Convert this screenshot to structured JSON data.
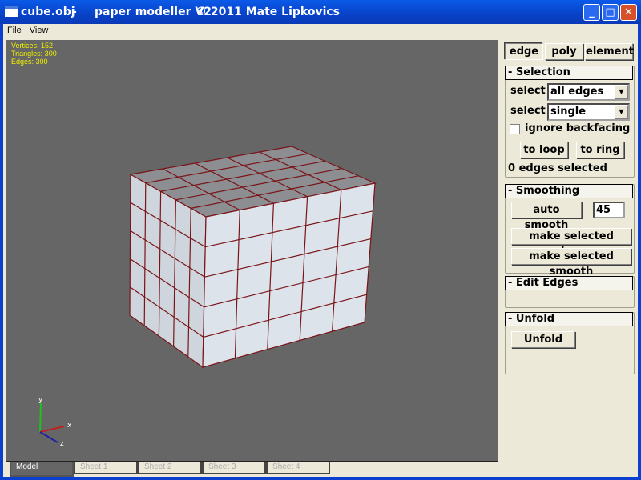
{
  "window": {
    "file": "cube.obj",
    "sep": "-",
    "app": "paper modeller V2",
    "copyright": "© 2011 Mate Lipkovics",
    "minimize": "_",
    "maximize": "□",
    "close": "✕"
  },
  "menu": [
    "File",
    "View"
  ],
  "stats": {
    "vertices": "Vertices: 152",
    "triangles": "Triangles: 300",
    "edges": "Edges: 300",
    "stats_color": "#f0f000"
  },
  "axes": {
    "x": "x",
    "y": "y",
    "z": "z"
  },
  "tabs": [
    {
      "label": "Model",
      "active": true
    },
    {
      "label": "Sheet 1"
    },
    {
      "label": "Sheet 2"
    },
    {
      "label": "Sheet 3"
    },
    {
      "label": "Sheet 4"
    }
  ],
  "mode_buttons": [
    {
      "label": "edge",
      "active": true
    },
    {
      "label": "poly"
    },
    {
      "label": "element"
    }
  ],
  "selection": {
    "title": "- Selection",
    "select_label": "select",
    "select1": "all edges",
    "select2": "single",
    "ignore_backfacing": "ignore backfacing",
    "ignore_checked": false,
    "to_loop": "to loop",
    "to_ring": "to ring",
    "status": "0 edges selected"
  },
  "smoothing": {
    "title": "- Smoothing",
    "auto_smooth": "auto smooth",
    "angle": "45",
    "make_sharp": "make selected sharp",
    "make_smooth": "make selected smooth"
  },
  "edit_edges": {
    "title": "- Edit Edges"
  },
  "unfold": {
    "title": "- Unfold",
    "button": "Unfold"
  },
  "colors": {
    "edge": "#7a1418",
    "front_face": "#dde3ea",
    "side_face": "#cfd5dc",
    "top_face": "#8c8e92",
    "viewport": "#666666"
  }
}
